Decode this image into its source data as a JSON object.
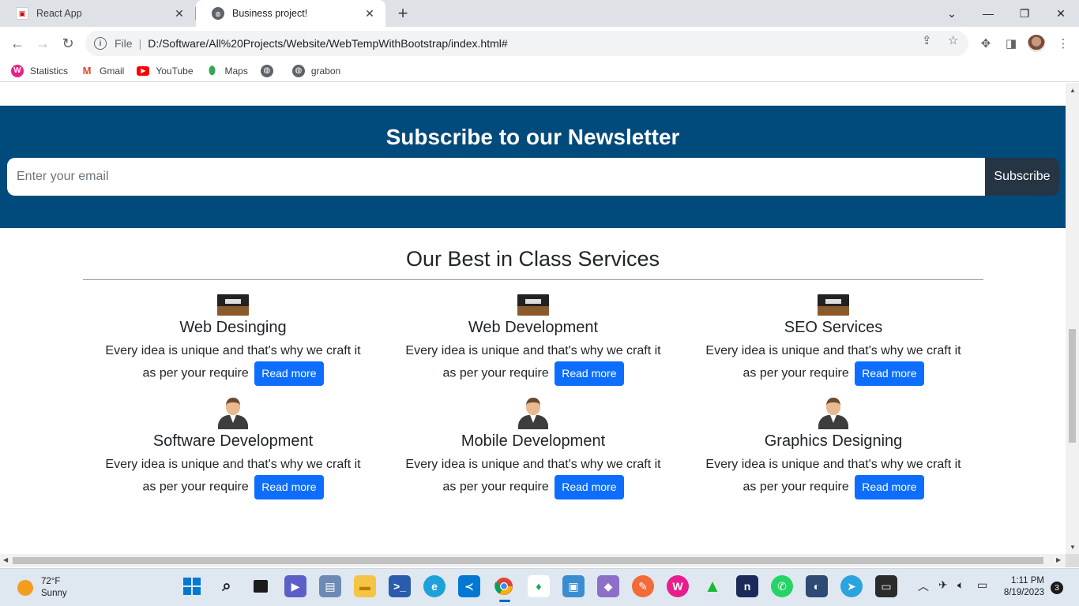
{
  "browser": {
    "tabs": [
      {
        "title": "React App",
        "favicon": "react-app-icon"
      },
      {
        "title": "Business project!",
        "favicon": "globe-icon"
      }
    ],
    "address": {
      "scheme": "File",
      "url": "D:/Software/All%20Projects/Website/WebTempWithBootstrap/index.html#"
    },
    "bookmarks": [
      {
        "label": "Statistics",
        "icon": "statistics-icon",
        "color": "#e91e8c"
      },
      {
        "label": "Gmail",
        "icon": "gmail-icon",
        "color": "#ea4335"
      },
      {
        "label": "YouTube",
        "icon": "youtube-icon",
        "color": "#ff0000"
      },
      {
        "label": "Maps",
        "icon": "maps-icon",
        "color": "#34a853"
      },
      {
        "label": "",
        "icon": "globe-icon",
        "color": "#5f6368"
      },
      {
        "label": "grabon",
        "icon": "globe-icon",
        "color": "#5f6368"
      }
    ]
  },
  "newsletter": {
    "title": "Subscribe to our Newsletter",
    "email_placeholder": "Enter your email",
    "button_label": "Subscribe",
    "bg_color": "#004a7c"
  },
  "services": {
    "title": "Our Best in Class Services",
    "read_more_label": "Read more",
    "items": [
      {
        "name": "Web Desinging",
        "desc": "Every idea is unique and that's why we craft it as per your require",
        "image": "laptop-thumbnail"
      },
      {
        "name": "Web Development",
        "desc": "Every idea is unique and that's why we craft it as per your require",
        "image": "laptop-thumbnail"
      },
      {
        "name": "SEO Services",
        "desc": "Every idea is unique and that's why we craft it as per your require",
        "image": "laptop-thumbnail"
      },
      {
        "name": "Software Development",
        "desc": "Every idea is unique and that's why we craft it as per your require",
        "image": "person-avatar"
      },
      {
        "name": "Mobile Development",
        "desc": "Every idea is unique and that's why we craft it as per your require",
        "image": "person-avatar"
      },
      {
        "name": "Graphics Designing",
        "desc": "Every idea is unique and that's why we craft it as per your require",
        "image": "person-avatar"
      }
    ]
  },
  "taskbar": {
    "weather_temp": "72°F",
    "weather_desc": "Sunny",
    "time": "1:11 PM",
    "date": "8/19/2023",
    "notification_count": "3"
  }
}
